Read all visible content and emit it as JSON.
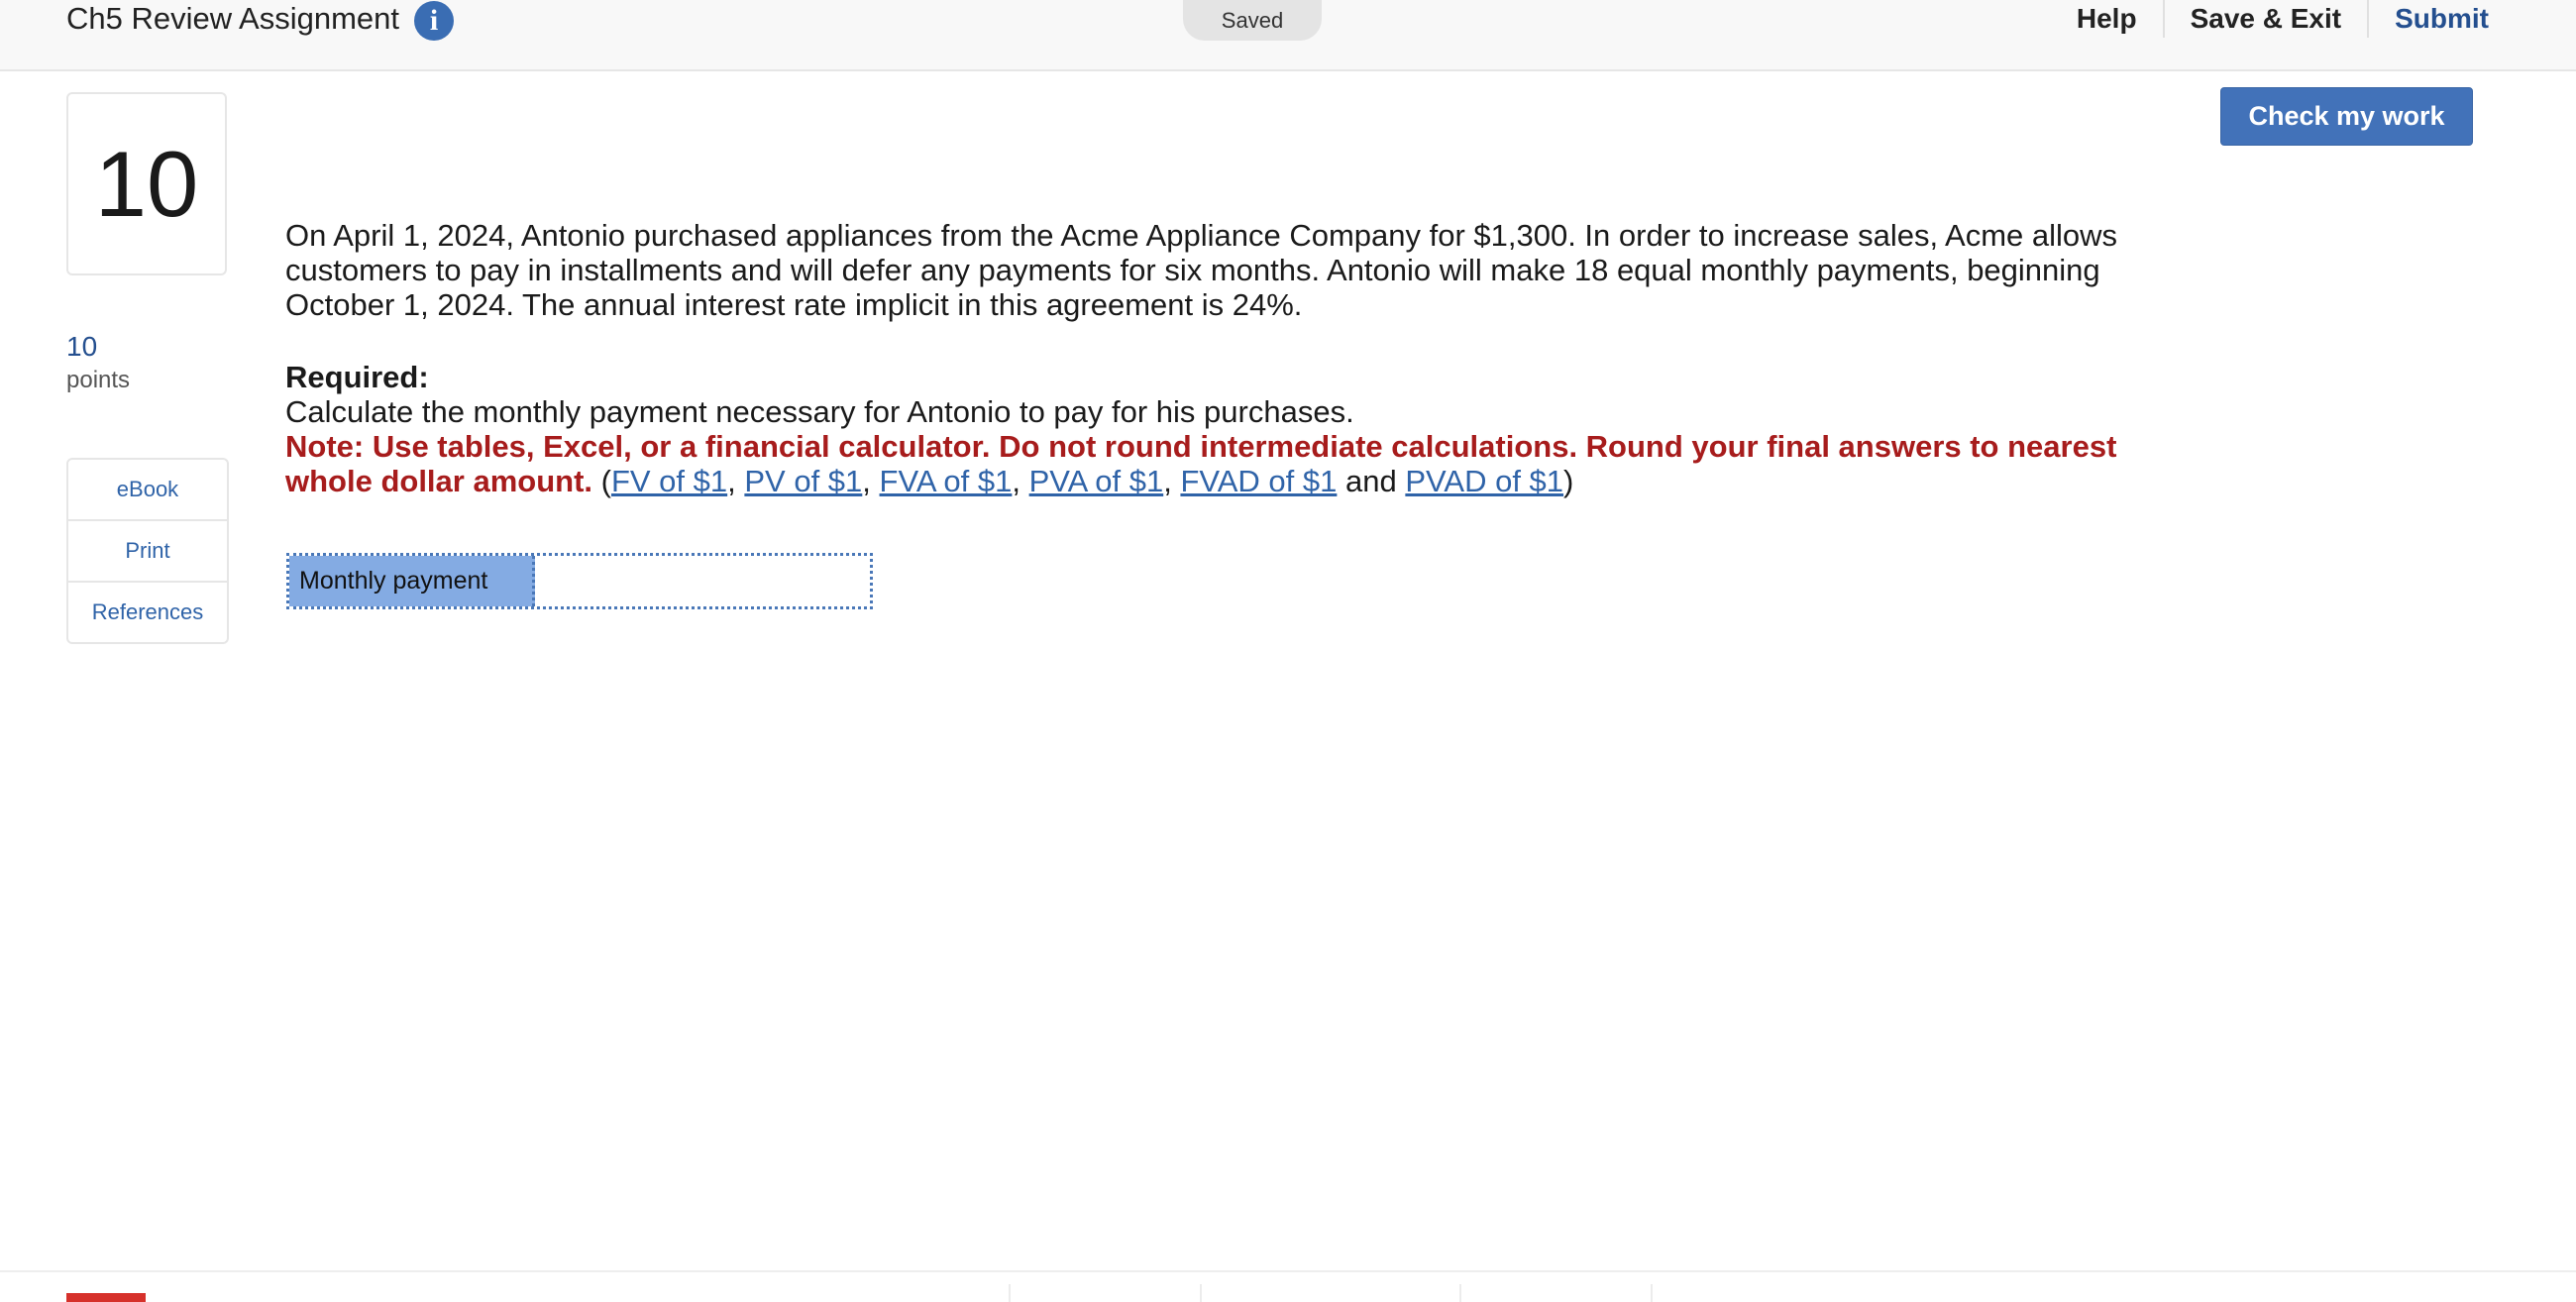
{
  "header": {
    "title": "Ch5 Review Assignment",
    "info_icon": "i",
    "saved": "Saved",
    "help": "Help",
    "save_exit": "Save & Exit",
    "submit": "Submit"
  },
  "question": {
    "number": "10",
    "points_value": "10",
    "points_label": "points",
    "text": "On April 1, 2024, Antonio purchased appliances from the Acme Appliance Company for $1,300. In order to increase sales, Acme allows customers to pay in installments and will defer any payments for six months. Antonio will make 18 equal monthly payments, beginning October 1, 2024. The annual interest rate implicit in this agreement is 24%.",
    "required_label": "Required:",
    "instruction": "Calculate the monthly payment necessary for Antonio to pay for his purchases.",
    "note": "Note: Use tables, Excel, or a financial calculator. Do not round intermediate calculations. Round your final answers to nearest whole dollar amount.",
    "links": {
      "fv": "FV of $1",
      "pv": "PV of $1",
      "fva": "FVA of $1",
      "pva": "PVA of $1",
      "fvad": "FVAD of $1",
      "pvad": "PVAD of $1"
    },
    "and": "and"
  },
  "tools": [
    "eBook",
    "Print",
    "References"
  ],
  "check_button": "Check my work",
  "answer": {
    "label": "Monthly payment",
    "value": ""
  },
  "colors": {
    "accent": "#4272b9",
    "note_red": "#a71c1c",
    "answer_label_bg": "#84abe3"
  }
}
